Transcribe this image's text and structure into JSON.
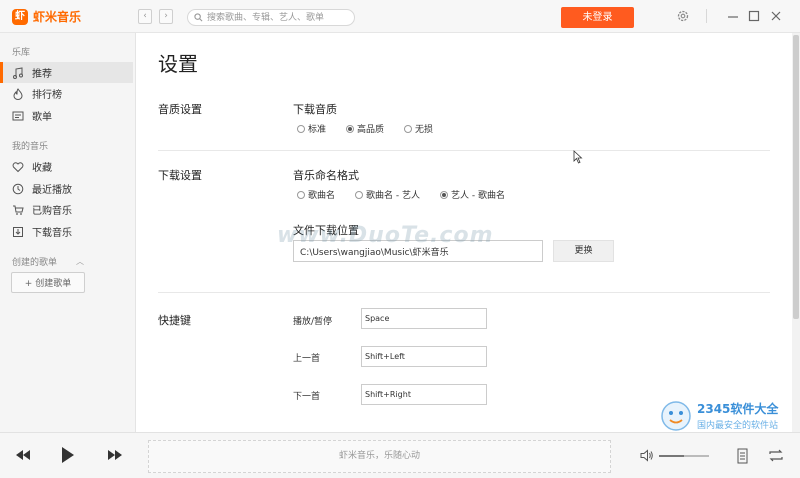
{
  "app": {
    "logo_mark": "虾",
    "name": "虾米音乐"
  },
  "titlebar": {
    "back_label": "‹",
    "forward_label": "›",
    "search_placeholder": "搜索歌曲、专辑、艺人、歌单",
    "login_label": "未登录"
  },
  "sidebar": {
    "section_library": "乐库",
    "library_items": [
      {
        "label": "推荐",
        "icon": "music-note-icon"
      },
      {
        "label": "排行榜",
        "icon": "flame-icon"
      },
      {
        "label": "歌单",
        "icon": "playlist-icon"
      }
    ],
    "section_my": "我的音乐",
    "my_items": [
      {
        "label": "收藏",
        "icon": "heart-icon"
      },
      {
        "label": "最近播放",
        "icon": "clock-icon"
      },
      {
        "label": "已购音乐",
        "icon": "cart-icon"
      },
      {
        "label": "下载音乐",
        "icon": "download-icon"
      }
    ],
    "section_created": "创建的歌单",
    "create_label": "+ 创建歌单"
  },
  "settings": {
    "title": "设置",
    "quality": {
      "section": "音质设置",
      "sub": "下载音质",
      "options": [
        "标准",
        "高品质",
        "无损"
      ],
      "selected": "高品质"
    },
    "download": {
      "section": "下载设置",
      "naming_sub": "音乐命名格式",
      "naming_options": [
        "歌曲名",
        "歌曲名 - 艺人",
        "艺人 - 歌曲名"
      ],
      "naming_selected": "艺人 - 歌曲名",
      "location_sub": "文件下载位置",
      "path": "C:\\Users\\wangjiao\\Music\\虾米音乐",
      "change_label": "更换"
    },
    "hotkeys": {
      "section": "快捷键",
      "items": [
        {
          "label": "播放/暂停",
          "value": "Space"
        },
        {
          "label": "上一首",
          "value": "Shift+Left"
        },
        {
          "label": "下一首",
          "value": "Shift+Right"
        }
      ]
    }
  },
  "player": {
    "now_playing": "虾米音乐，乐随心动",
    "volume": 0.5
  },
  "watermarks": {
    "center": "www.DuoTe.com",
    "corner_title": "2345软件大全",
    "corner_sub": "国内最安全的软件站"
  },
  "colors": {
    "accent": "#ff6a00",
    "login": "#ff5b1f"
  }
}
